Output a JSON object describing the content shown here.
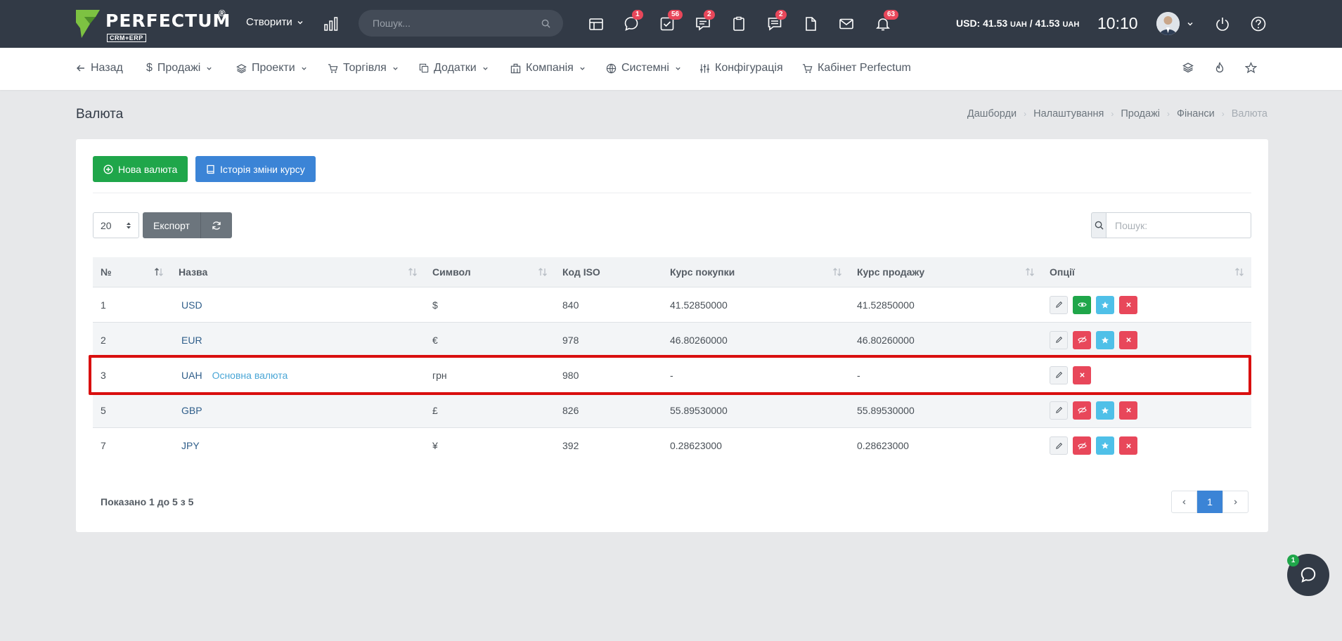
{
  "app": {
    "brand": "PERFECTUM",
    "brand_mark": "®",
    "brand_sub": "CRM+ERP"
  },
  "topbar": {
    "create_label": "Створити",
    "search_placeholder": "Пошук...",
    "icons": [
      {
        "name": "calendar-grid-icon",
        "badge": ""
      },
      {
        "name": "chat-bubble-icon",
        "badge": "1"
      },
      {
        "name": "tasks-check-icon",
        "badge": "56"
      },
      {
        "name": "comments-icon",
        "badge": "2"
      },
      {
        "name": "clipboard-icon",
        "badge": ""
      },
      {
        "name": "messages-icon",
        "badge": "2"
      },
      {
        "name": "file-icon",
        "badge": ""
      },
      {
        "name": "mail-icon",
        "badge": ""
      },
      {
        "name": "bell-icon",
        "badge": "63"
      }
    ],
    "rate_prefix": "USD: 41.53",
    "rate_unit_1": "UAH",
    "rate_mid": " / 41.53 ",
    "rate_unit_2": "UAH",
    "clock": "10:10"
  },
  "nav": {
    "back": "Назад",
    "sales": "Продажі",
    "projects": "Проекти",
    "trade": "Торгівля",
    "addons": "Додатки",
    "company": "Компанія",
    "system": "Системні",
    "config": "Конфігурація",
    "cabinet": "Кабінет Perfectum"
  },
  "page": {
    "title": "Валюта",
    "breadcrumbs": [
      "Дашборди",
      "Налаштування",
      "Продажі",
      "Фінанси",
      "Валюта"
    ]
  },
  "toolbar": {
    "new_currency": "Нова валюта",
    "rate_history": "Історія зміни курсу",
    "page_size": "20",
    "export": "Експорт",
    "search_placeholder": "Пошук:"
  },
  "table": {
    "headers": [
      "№",
      "Назва",
      "Символ",
      "Код ISO",
      "Курс покупки",
      "Курс продажу",
      "Опції"
    ],
    "rows": [
      {
        "num": "1",
        "name": "USD",
        "tag": "",
        "symbol": "$",
        "iso": "840",
        "buy": "41.52850000",
        "sell": "41.52850000"
      },
      {
        "num": "2",
        "name": "EUR",
        "tag": "",
        "symbol": "€",
        "iso": "978",
        "buy": "46.80260000",
        "sell": "46.80260000"
      },
      {
        "num": "3",
        "name": "UAH",
        "tag": "Основна валюта",
        "symbol": "грн",
        "iso": "980",
        "buy": "-",
        "sell": "-"
      },
      {
        "num": "5",
        "name": "GBP",
        "tag": "",
        "symbol": "£",
        "iso": "826",
        "buy": "55.89530000",
        "sell": "55.89530000"
      },
      {
        "num": "7",
        "name": "JPY",
        "tag": "",
        "symbol": "¥",
        "iso": "392",
        "buy": "0.28623000",
        "sell": "0.28623000"
      }
    ],
    "info": "Показано 1 до 5 з 5"
  },
  "pagination": {
    "current": "1"
  },
  "chat": {
    "badge": "1"
  },
  "colors": {
    "topbar": "#323a46",
    "green": "#1fa64a",
    "blue": "#3b84d6",
    "red": "#e8475a",
    "cyan": "#4fc0e8",
    "highlight": "#d90f0f"
  }
}
